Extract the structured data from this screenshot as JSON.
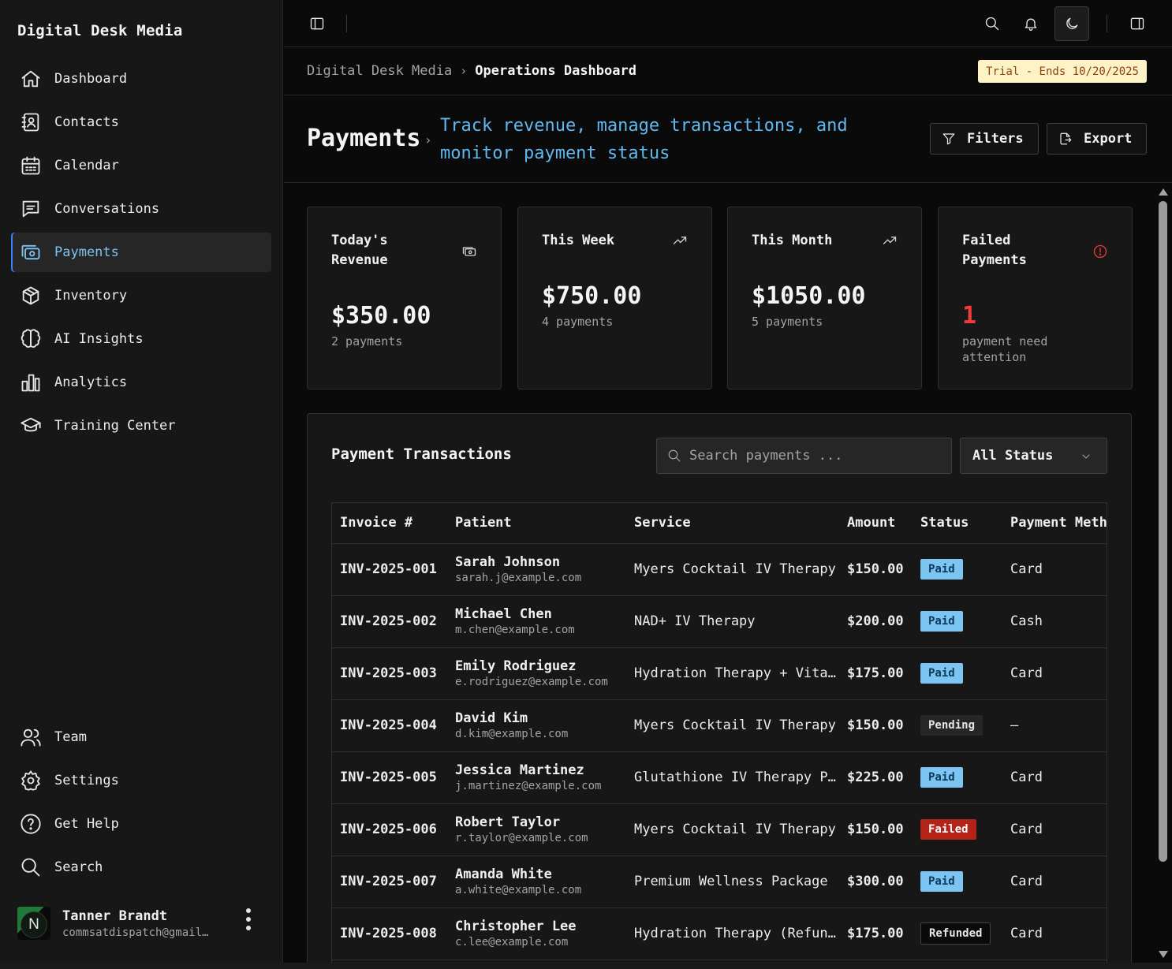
{
  "app": {
    "brand": "Digital Desk Media"
  },
  "sidebar": {
    "items": [
      {
        "label": "Dashboard",
        "icon": "home-icon"
      },
      {
        "label": "Contacts",
        "icon": "contacts-icon"
      },
      {
        "label": "Calendar",
        "icon": "calendar-icon"
      },
      {
        "label": "Conversations",
        "icon": "message-icon"
      },
      {
        "label": "Payments",
        "icon": "payments-icon",
        "active": true
      },
      {
        "label": "Inventory",
        "icon": "box-icon"
      },
      {
        "label": "AI Insights",
        "icon": "brain-icon"
      },
      {
        "label": "Analytics",
        "icon": "bar-chart-icon"
      },
      {
        "label": "Training Center",
        "icon": "graduation-cap-icon"
      }
    ],
    "bottom": [
      {
        "label": "Team",
        "icon": "users-icon"
      },
      {
        "label": "Settings",
        "icon": "gear-icon"
      },
      {
        "label": "Get Help",
        "icon": "help-circle-icon"
      },
      {
        "label": "Search",
        "icon": "search-icon"
      }
    ],
    "user": {
      "initial": "N",
      "name": "Tanner Brandt",
      "email": "commsatdispatch@gmail…"
    }
  },
  "topbar": {
    "icons": [
      "sidebar-toggle-icon",
      "search-icon",
      "bell-icon",
      "moon-icon",
      "panel-right-icon"
    ]
  },
  "breadcrumb": {
    "parent": "Digital Desk Media",
    "separator": "›",
    "current": "Operations Dashboard"
  },
  "trial": {
    "label": "Trial - Ends 10/20/2025",
    "bg": "#fef3c7",
    "fg": "#92400e"
  },
  "header": {
    "title": "Payments",
    "chevron": "›",
    "subtitle": "Track revenue, manage transactions, and monitor payment status",
    "filters_label": "Filters",
    "export_label": "Export"
  },
  "stats": [
    {
      "title": "Today's Revenue",
      "value": "$350.00",
      "sub": "2 payments",
      "icon": "cash-icon"
    },
    {
      "title": "This Week",
      "value": "$750.00",
      "sub": "4 payments",
      "icon": "trending-up-icon"
    },
    {
      "title": "This Month",
      "value": "$1050.00",
      "sub": "5 payments",
      "icon": "trending-up-icon"
    },
    {
      "title": "Failed Payments",
      "value": "1",
      "sub": "payment need attention",
      "icon": "alert-circle-icon"
    }
  ],
  "transactions": {
    "title": "Payment Transactions",
    "search_placeholder": "Search payments ...",
    "status_filter": "All Status",
    "columns": [
      "Invoice #",
      "Patient",
      "Service",
      "Amount",
      "Status",
      "Payment Method"
    ],
    "rows": [
      {
        "invoice": "INV-2025-001",
        "name": "Sarah Johnson",
        "email": "sarah.j@example.com",
        "service": "Myers Cocktail IV Therapy",
        "amount": "$150.00",
        "status": "Paid",
        "method": "Card"
      },
      {
        "invoice": "INV-2025-002",
        "name": "Michael Chen",
        "email": "m.chen@example.com",
        "service": "NAD+ IV Therapy",
        "amount": "$200.00",
        "status": "Paid",
        "method": "Cash"
      },
      {
        "invoice": "INV-2025-003",
        "name": "Emily Rodriguez",
        "email": "e.rodriguez@example.com",
        "service": "Hydration Therapy + Vitamin Boost",
        "amount": "$175.00",
        "status": "Paid",
        "method": "Card"
      },
      {
        "invoice": "INV-2025-004",
        "name": "David Kim",
        "email": "d.kim@example.com",
        "service": "Myers Cocktail IV Therapy",
        "amount": "$150.00",
        "status": "Pending",
        "method": "—"
      },
      {
        "invoice": "INV-2025-005",
        "name": "Jessica Martinez",
        "email": "j.martinez@example.com",
        "service": "Glutathione IV Therapy Plus",
        "amount": "$225.00",
        "status": "Paid",
        "method": "Card"
      },
      {
        "invoice": "INV-2025-006",
        "name": "Robert Taylor",
        "email": "r.taylor@example.com",
        "service": "Myers Cocktail IV Therapy",
        "amount": "$150.00",
        "status": "Failed",
        "method": "Card"
      },
      {
        "invoice": "INV-2025-007",
        "name": "Amanda White",
        "email": "a.white@example.com",
        "service": "Premium Wellness Package",
        "amount": "$300.00",
        "status": "Paid",
        "method": "Card"
      },
      {
        "invoice": "INV-2025-008",
        "name": "Christopher Lee",
        "email": "c.lee@example.com",
        "service": "Hydration Therapy (Refund)",
        "amount": "$175.00",
        "status": "Refunded",
        "method": "Card"
      }
    ]
  },
  "colors": {
    "accent": "#7cc4f2",
    "subtitle": "#60b8f0",
    "danger": "#ef3b3b",
    "failed_badge": "#b42318"
  }
}
